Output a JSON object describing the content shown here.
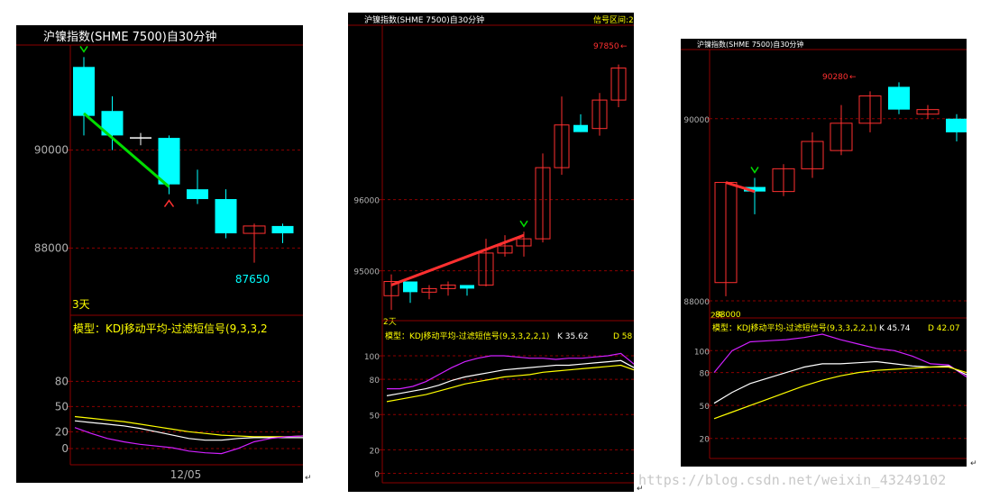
{
  "watermark": "https://blog.csdn.net/weixin_43249102",
  "para_marks": [
    "↵",
    "↵",
    "↵"
  ],
  "chart_data": [
    {
      "type": "candlestick",
      "title": "沪镍指数(SHME 7500)自30分钟",
      "period_label": "3天",
      "x_tick": "12/05",
      "price_ticks": [
        90000,
        88000
      ],
      "price_range": [
        86700,
        92000
      ],
      "candles": [
        {
          "o": 90700,
          "h": 91900,
          "l": 90300,
          "c": 91700,
          "color": "cyan"
        },
        {
          "o": 90300,
          "h": 91100,
          "l": 90000,
          "c": 90800,
          "color": "cyan"
        },
        {
          "o": 90250,
          "h": 90350,
          "l": 90100,
          "c": 90250,
          "color": "white"
        },
        {
          "o": 89300,
          "h": 90300,
          "l": 89100,
          "c": 90250,
          "color": "cyan"
        },
        {
          "o": 89000,
          "h": 89600,
          "l": 88900,
          "c": 89200,
          "color": "cyan"
        },
        {
          "o": 88300,
          "h": 89200,
          "l": 88200,
          "c": 89000,
          "color": "cyan"
        },
        {
          "o": 88300,
          "h": 88500,
          "l": 87700,
          "c": 88450,
          "color": "red"
        },
        {
          "o": 88300,
          "h": 88500,
          "l": 88100,
          "c": 88450,
          "color": "cyan"
        }
      ],
      "low_label": "87650",
      "signals": [
        {
          "candle": 0,
          "type": "buy"
        },
        {
          "candle": 3,
          "type": "sell"
        }
      ],
      "trend_line": {
        "from": {
          "candle": 0,
          "value": 90750
        },
        "to": {
          "candle": 3,
          "value": 89250
        },
        "color": "green"
      },
      "indicator": {
        "label": "模型：KDJ移动平均-过滤短信号(9,3,3,2",
        "ticks": [
          80,
          50,
          20,
          0
        ],
        "range": [
          -15,
          105
        ],
        "x": [
          0,
          1,
          2,
          3,
          4,
          5,
          6,
          7,
          8,
          9,
          10,
          11,
          12,
          13,
          14
        ],
        "series": [
          {
            "color": "yellow",
            "values": [
              38,
              36,
              34,
              32,
              29,
              26,
              23,
              20,
              18,
              16,
              15,
              14,
              14,
              14,
              15
            ]
          },
          {
            "color": "white",
            "values": [
              33,
              31,
              29,
              27,
              24,
              20,
              16,
              12,
              10,
              10,
              12,
              13,
              13,
              13,
              13
            ]
          },
          {
            "color": "magenta",
            "values": [
              25,
              18,
              12,
              8,
              5,
              3,
              1,
              -3,
              -5,
              -6,
              0,
              8,
              12,
              14,
              15
            ]
          }
        ]
      }
    },
    {
      "type": "candlestick",
      "title": "沪镍指数(SHME 7500)自30分钟",
      "signal_zone_label": "信号区间:2",
      "period_label": "2天",
      "price_ticks": [
        96000,
        95000
      ],
      "price_range": [
        94350,
        98300
      ],
      "candles": [
        {
          "o": 94650,
          "h": 94950,
          "l": 94450,
          "c": 94850,
          "color": "red"
        },
        {
          "o": 94700,
          "h": 94800,
          "l": 94550,
          "c": 94850,
          "color": "cyan"
        },
        {
          "o": 94700,
          "h": 94800,
          "l": 94600,
          "c": 94750,
          "color": "red"
        },
        {
          "o": 94750,
          "h": 94850,
          "l": 94650,
          "c": 94800,
          "color": "red"
        },
        {
          "o": 94750,
          "h": 94800,
          "l": 94650,
          "c": 94800,
          "color": "cyan"
        },
        {
          "o": 94800,
          "h": 95450,
          "l": 94780,
          "c": 95250,
          "color": "red"
        },
        {
          "o": 95250,
          "h": 95500,
          "l": 95200,
          "c": 95350,
          "color": "red"
        },
        {
          "o": 95350,
          "h": 95550,
          "l": 95200,
          "c": 95450,
          "color": "red"
        },
        {
          "o": 95450,
          "h": 96650,
          "l": 95400,
          "c": 96450,
          "color": "red"
        },
        {
          "o": 96450,
          "h": 97450,
          "l": 96350,
          "c": 97050,
          "color": "red"
        },
        {
          "o": 97050,
          "h": 97200,
          "l": 96950,
          "c": 96950,
          "color": "cyan"
        },
        {
          "o": 97000,
          "h": 97500,
          "l": 96900,
          "c": 97400,
          "color": "red"
        },
        {
          "o": 97400,
          "h": 97900,
          "l": 97300,
          "c": 97850,
          "color": "red"
        }
      ],
      "high_label": "97850",
      "signals": [
        {
          "candle": 7,
          "type": "buy"
        }
      ],
      "trend_line": {
        "from": {
          "candle": 0,
          "value": 94800
        },
        "to": {
          "candle": 7,
          "value": 95500
        },
        "color": "red"
      },
      "indicator": {
        "label": "模型：KDJ移动平均-过滤短信号(9,3,3,2,2,1)",
        "k_label": "K 35.62",
        "d_label": "D 58",
        "ticks": [
          100,
          80,
          50,
          20,
          0
        ],
        "range": [
          -5,
          110
        ],
        "x": [
          0,
          1,
          2,
          3,
          4,
          5,
          6,
          7,
          8,
          9,
          10,
          11,
          12,
          13,
          14,
          15,
          16,
          17,
          18,
          19
        ],
        "series": [
          {
            "color": "magenta",
            "values": [
              72,
              72,
              74,
              78,
              84,
              90,
              95,
              98,
              100,
              100,
              99,
              98,
              98,
              97,
              98,
              98,
              99,
              100,
              102,
              93
            ]
          },
          {
            "color": "white",
            "values": [
              66,
              68,
              70,
              72,
              75,
              79,
              82,
              84,
              86,
              88,
              89,
              90,
              91,
              92,
              92,
              93,
              94,
              95,
              96,
              90
            ]
          },
          {
            "color": "yellow",
            "values": [
              61,
              63,
              65,
              67,
              70,
              73,
              76,
              78,
              80,
              82,
              83,
              84,
              86,
              87,
              88,
              89,
              90,
              91,
              92,
              88
            ]
          }
        ]
      }
    },
    {
      "type": "candlestick",
      "title": "沪镍指数(SHME 7500)自30分钟",
      "period_label": "2天",
      "price_ticks": [
        90000,
        88000
      ],
      "price_range": [
        87950,
        90700
      ],
      "candles": [
        {
          "o": 88200,
          "h": 89300,
          "l": 88050,
          "c": 89300,
          "color": "red"
        },
        {
          "o": 89250,
          "h": 89350,
          "l": 88950,
          "c": 89200,
          "color": "cyan"
        },
        {
          "o": 89200,
          "h": 89500,
          "l": 89150,
          "c": 89450,
          "color": "red"
        },
        {
          "o": 89450,
          "h": 89850,
          "l": 89350,
          "c": 89750,
          "color": "red"
        },
        {
          "o": 89650,
          "h": 90150,
          "l": 89600,
          "c": 89950,
          "color": "red"
        },
        {
          "o": 89950,
          "h": 90300,
          "l": 89850,
          "c": 90250,
          "color": "red"
        },
        {
          "o": 90100,
          "h": 90400,
          "l": 90050,
          "c": 90350,
          "color": "cyan"
        },
        {
          "o": 90050,
          "h": 90150,
          "l": 90000,
          "c": 90100,
          "color": "red"
        },
        {
          "o": 89850,
          "h": 90050,
          "l": 89750,
          "c": 90000,
          "color": "cyan"
        },
        {
          "o": 89850,
          "h": 89950,
          "l": 89750,
          "c": 89950,
          "color": "red"
        }
      ],
      "high_label": "90280",
      "low_label": "88000",
      "signals": [
        {
          "candle": 1,
          "type": "buy"
        }
      ],
      "trend_line": {
        "from": {
          "candle": 0,
          "value": 89300
        },
        "to": {
          "candle": 1,
          "value": 89200
        },
        "color": "red"
      },
      "indicator": {
        "label": "模型：KDJ移动平均-过滤短信号(9,3,3,2,2,1)",
        "k_label": "K 45.74",
        "d_label": "D 42.07",
        "ticks": [
          100,
          80,
          50,
          20
        ],
        "range": [
          5,
          115
        ],
        "x": [
          0,
          1,
          2,
          3,
          4,
          5,
          6,
          7,
          8,
          9,
          10,
          11,
          12,
          13,
          14
        ],
        "series": [
          {
            "color": "magenta",
            "values": [
              80,
              100,
              108,
              109,
              110,
              112,
              115,
              110,
              106,
              102,
              100,
              95,
              88,
              87,
              76
            ]
          },
          {
            "color": "white",
            "values": [
              52,
              62,
              70,
              75,
              80,
              85,
              88,
              88,
              89,
              90,
              88,
              86,
              85,
              86,
              78
            ]
          },
          {
            "color": "yellow",
            "values": [
              38,
              44,
              50,
              56,
              62,
              68,
              73,
              77,
              80,
              82,
              83,
              84,
              85,
              85,
              80
            ]
          }
        ]
      }
    }
  ]
}
